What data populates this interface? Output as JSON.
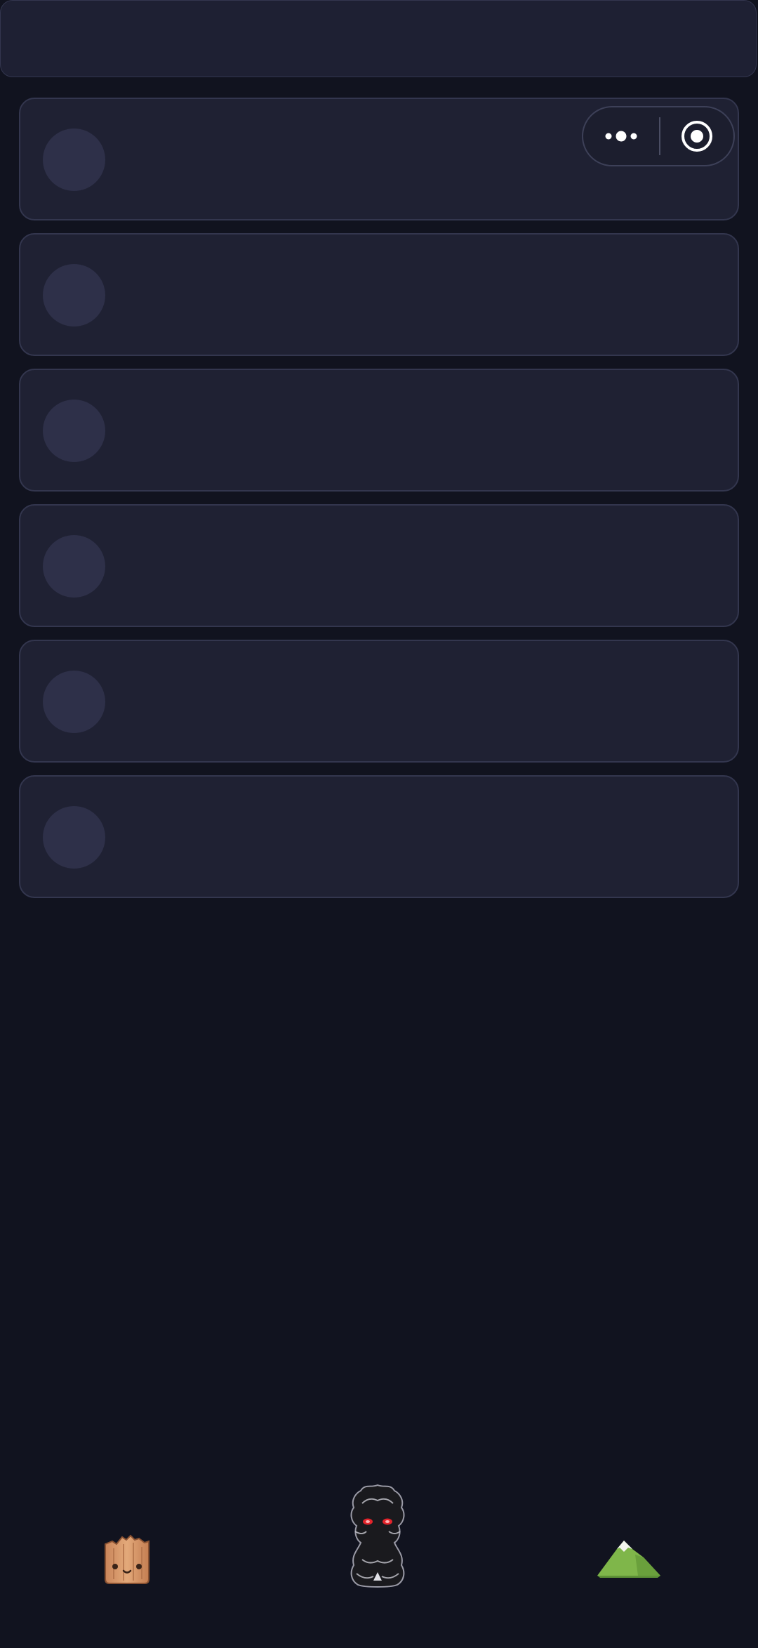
{
  "header": {
    "title": ""
  },
  "capsule": {
    "menu_icon": "more-dots-icon",
    "close_icon": "target-close-icon"
  },
  "list": {
    "items": [
      {
        "placeholder": true
      },
      {
        "placeholder": true
      },
      {
        "placeholder": true
      },
      {
        "placeholder": true
      },
      {
        "placeholder": true
      },
      {
        "placeholder": true
      }
    ]
  },
  "bottom_nav": {
    "items": [
      {
        "icon": "wood-stump-icon"
      },
      {
        "icon": "shadow-creature-icon"
      },
      {
        "icon": "green-mountain-icon"
      }
    ]
  },
  "colors": {
    "background": "#11131f",
    "card": "#1f2133",
    "card_border": "#33364e",
    "avatar_placeholder": "#2e3049"
  }
}
